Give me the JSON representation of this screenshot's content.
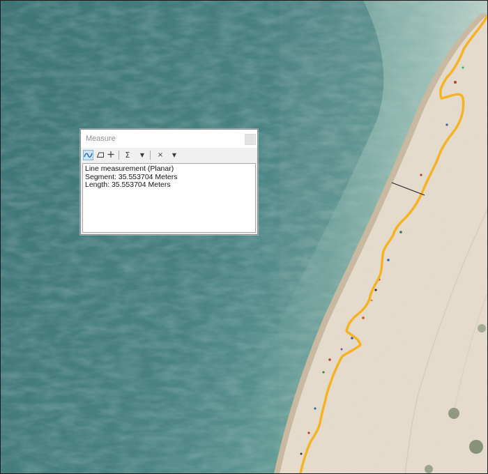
{
  "measure_window": {
    "title": "Measure",
    "toolbar": {
      "line_tool_icon": "polyline-measure-icon",
      "area_tool_icon": "polygon-measure-icon",
      "feature_tool_icon": "crosshair-icon",
      "sum_tool_glyph": "Σ",
      "dropdown_glyph": "▼",
      "clear_tool_glyph": "×"
    },
    "results": {
      "line_1": "Line measurement (Planar)",
      "line_2": "Segment: 35.553704 Meters",
      "line_3": "Length: 35.553704 Meters"
    }
  },
  "map": {
    "colors": {
      "sea_deep": "#41787a",
      "sea_shallow": "#8fb7ad",
      "sand": "#e6ddcf",
      "shoreline": "#f5b324",
      "measure_line": "#202020"
    }
  }
}
